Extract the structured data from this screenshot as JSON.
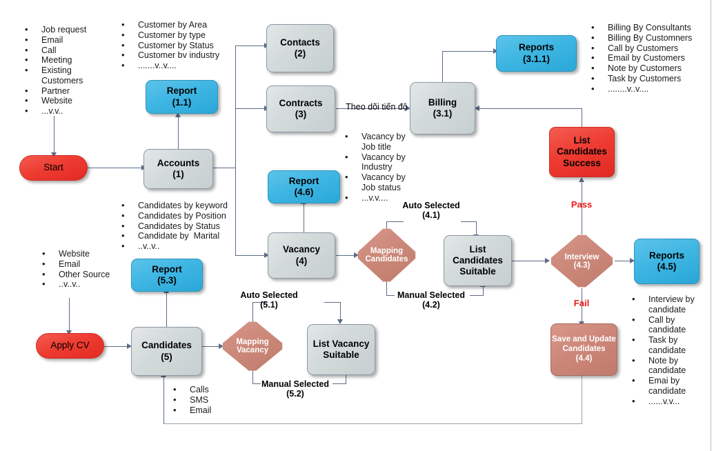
{
  "diagram": {
    "title": "Recruitment CRM process flow",
    "colors": {
      "blue": "#33aeda",
      "red": "#ee3c32",
      "grey": "#d3dada",
      "salmon": "#cb8879",
      "connector": "#5b6b86",
      "label_red": "#ee1b17"
    }
  },
  "nodes": {
    "start": {
      "line1": "Start",
      "line2": ""
    },
    "apply_cv": {
      "line1": "Apply CV",
      "line2": ""
    },
    "accounts": {
      "line1": "Accounts",
      "line2": "(1)"
    },
    "report_11": {
      "line1": "Report",
      "line2": "(1.1)"
    },
    "contacts": {
      "line1": "Contacts",
      "line2": "(2)"
    },
    "contracts": {
      "line1": "Contracts",
      "line2": "(3)"
    },
    "billing": {
      "line1": "Billing",
      "line2": "(3.1)"
    },
    "reports_311": {
      "line1": "Reports",
      "line2": "(3.1.1)"
    },
    "list_candidates_success": {
      "line1": "List",
      "line2": "Candidates",
      "line3": "Success"
    },
    "report_46": {
      "line1": "Report",
      "line2": "(4.6)"
    },
    "vacancy": {
      "line1": "Vacancy",
      "line2": "(4)"
    },
    "mapping_candidates": {
      "line1": "Mapping",
      "line2": "Candidates"
    },
    "list_candidates_suitable": {
      "line1": "List",
      "line2": "Candidates",
      "line3": "Suitable"
    },
    "interview": {
      "line1": "Interview",
      "line2": "(4.3)"
    },
    "reports_45": {
      "line1": "Reports",
      "line2": "(4.5)"
    },
    "save_update_candidates": {
      "line1": "Save and Update",
      "line2": "Candidates",
      "line3": "(4.4)"
    },
    "report_53": {
      "line1": "Report",
      "line2": "(5.3)"
    },
    "candidates": {
      "line1": "Candidates",
      "line2": "(5)"
    },
    "mapping_vacancy": {
      "line1": "Mapping",
      "line2": "Vacancy"
    },
    "list_vacancy_suitable": {
      "line1": "List Vacancy",
      "line2": "Suitable"
    }
  },
  "edge_labels": {
    "theo_doi_tien_do": "Theo dõi tiến độ",
    "auto_selected_41_l1": "Auto Selected",
    "auto_selected_41_l2": "(4.1)",
    "manual_selected_42_l1": "Manual Selected",
    "manual_selected_42_l2": "(4.2)",
    "auto_selected_51_l1": "Auto Selected",
    "auto_selected_51_l2": "(5.1)",
    "manual_selected_52_l1": "Manual Selected",
    "manual_selected_52_l2": "(5.2)",
    "pass": "Pass",
    "fail": "Fail"
  },
  "lists": {
    "sources": [
      "Job request",
      "Email",
      "Call",
      "Meeting",
      "Existing",
      "Customers",
      "Partner",
      "Website",
      "...v.v.."
    ],
    "customer_reports": [
      "Customer by Area",
      "Customer by type",
      "Customer by Status",
      "Customer bv industry",
      ".......v..v...."
    ],
    "billing_reports": [
      "Billing By Consultants",
      "Billing By Customners",
      "Call by Customers",
      "Email by Customers",
      "Note by Customers",
      "Task by Customers",
      "........v..v...."
    ],
    "vacancy_reports": [
      "Vacancy by",
      "Job title",
      "Vacancy by",
      "Industry",
      "Vacancy by",
      "Job status",
      "...v.v...."
    ],
    "candidate_reports": [
      "Candidates by keyword",
      "Candidates by Position",
      "Candidates by Status",
      "Candidate by  Marital",
      "..v..v.."
    ],
    "candidate_sources": [
      "Website",
      "Email",
      "Other Source",
      "..v..v.."
    ],
    "interview_reports": [
      "Interview by",
      "candidate",
      "Call by",
      "candidate",
      "Task by",
      "candidate",
      "Note by",
      "candidate",
      "Emai by",
      "candidate",
      "......v.v..."
    ],
    "contact_channels": [
      "Calls",
      "SMS",
      "Email"
    ]
  }
}
